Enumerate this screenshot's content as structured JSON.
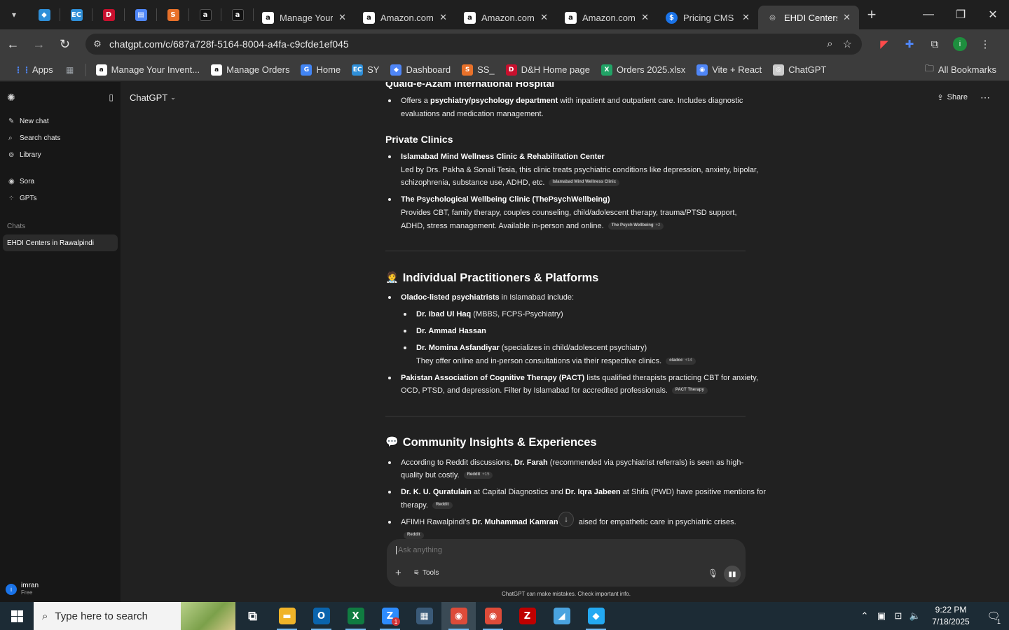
{
  "browser": {
    "pinned_tabs": [
      {
        "icon": "pinned-tab-edge-icon",
        "color": "#2f8fd8",
        "glyph": "◆"
      },
      {
        "icon": "pinned-tab-ec-icon",
        "color": "#2f8fd8",
        "glyph": "EC"
      },
      {
        "icon": "pinned-tab-dh-icon",
        "color": "#c8102e",
        "glyph": "D"
      },
      {
        "icon": "pinned-tab-doc-icon",
        "color": "#4f86f7",
        "glyph": "▤"
      },
      {
        "icon": "pinned-tab-ss-icon",
        "color": "#e8712a",
        "glyph": "S"
      },
      {
        "icon": "pinned-tab-amazon-icon",
        "color": "#ffffff",
        "glyph": "a"
      },
      {
        "icon": "pinned-tab-amazon-icon",
        "color": "#ffffff",
        "glyph": "a"
      }
    ],
    "tabs": [
      {
        "title": "Manage Your",
        "icon": "amazon-icon",
        "active": false
      },
      {
        "title": "Amazon.com",
        "icon": "amazon-icon",
        "active": false
      },
      {
        "title": "Amazon.com",
        "icon": "amazon-icon",
        "active": false
      },
      {
        "title": "Amazon.com",
        "icon": "amazon-icon",
        "active": false
      },
      {
        "title": "Pricing CMS",
        "icon": "dollar-icon",
        "active": false
      },
      {
        "title": "EHDI Centers",
        "icon": "openai-icon",
        "active": true
      }
    ],
    "url": "chatgpt.com/c/687a728f-5164-8004-a4fa-c9cfde1ef045",
    "bookmarks": [
      {
        "label": "Apps",
        "icon": "apps-grid-icon",
        "color": "#4f86f7",
        "glyph": "⋮⋮"
      },
      {
        "label": "",
        "icon": "tab-groups-icon",
        "color": "#9aa0a6",
        "glyph": "▦"
      },
      {
        "label": "Manage Your Invent...",
        "icon": "amazon-icon",
        "color": "#ffffff",
        "glyph": "a"
      },
      {
        "label": "Manage Orders",
        "icon": "amazon-icon",
        "color": "#ffffff",
        "glyph": "a"
      },
      {
        "label": "Home",
        "icon": "google-icon",
        "color": "#4285f4",
        "glyph": "G"
      },
      {
        "label": "SY",
        "icon": "ec-icon",
        "color": "#2f8fd8",
        "glyph": "EC"
      },
      {
        "label": "Dashboard",
        "icon": "dashboard-icon",
        "color": "#4f86f7",
        "glyph": "◆"
      },
      {
        "label": "SS_",
        "icon": "ss-icon",
        "color": "#e8712a",
        "glyph": "S"
      },
      {
        "label": "D&H Home page",
        "icon": "dh-icon",
        "color": "#c8102e",
        "glyph": "D"
      },
      {
        "label": "Orders 2025.xlsx",
        "icon": "excel-icon",
        "color": "#21a366",
        "glyph": "X"
      },
      {
        "label": "Vite + React",
        "icon": "vite-icon",
        "color": "#4f86f7",
        "glyph": "◉"
      },
      {
        "label": "ChatGPT",
        "icon": "openai-icon",
        "color": "#cccccc",
        "glyph": "◎"
      }
    ],
    "all_bookmarks": "All Bookmarks"
  },
  "sidebar": {
    "items": [
      {
        "label": "New chat",
        "icon": "compose-icon",
        "glyph": "✎"
      },
      {
        "label": "Search chats",
        "icon": "search-icon",
        "glyph": "⌕"
      },
      {
        "label": "Library",
        "icon": "library-icon",
        "glyph": "⊚"
      }
    ],
    "items2": [
      {
        "label": "Sora",
        "icon": "sora-icon",
        "glyph": "◉"
      },
      {
        "label": "GPTs",
        "icon": "gpts-icon",
        "glyph": "⁘"
      }
    ],
    "chats_heading": "Chats",
    "active_chat": "EHDI Centers in Rawalpindi",
    "user": {
      "name": "imran",
      "plan": "Free",
      "initial": "i"
    }
  },
  "header": {
    "model": "ChatGPT",
    "share": "Share"
  },
  "conversation": {
    "heading_cut": "Quaid-e-Azam International Hospital",
    "qi_lines": [
      {
        "b": "",
        "t": "Offers a ",
        "b2": "psychiatry/psychology department",
        "t2": " with inpatient and outpatient care. Includes diagnostic"
      },
      {
        "t": "evaluations and medication management."
      }
    ],
    "private_clinics": "Private Clinics",
    "pc1_title": "Islamabad Mind Wellness Clinic & Rehabilitation Center",
    "pc1_line1": "Led by Drs. Pakha & Sonali Tesia, this clinic treats psychiatric conditions like depression, anxiety, bipolar,",
    "pc1_line2": "schizophrenia, substance use, ADHD, etc.",
    "pc1_cite": "Islamabad Mind Wellness Clinic",
    "pc2_title": "The Psychological Wellbeing Clinic (ThePsychWellbeing)",
    "pc2_line1": "Provides CBT, family therapy, couples counseling, child/adolescent therapy, trauma/PTSD support,",
    "pc2_line2": "ADHD, stress management. Available in-person and online.",
    "pc2_cite": "The Psych Wellbeing",
    "pc2_cite_more": "+2",
    "ip_emoji": "🧑‍⚕️",
    "ip_heading": "Individual Practitioners & Platforms",
    "ip1_b": "Oladoc-listed psychiatrists",
    "ip1_t": " in Islamabad include:",
    "doc1_b": "Dr. Ibad Ul Haq",
    "doc1_t": " (MBBS, FCPS-Psychiatry)",
    "doc2_b": "Dr. Ammad Hassan",
    "doc3_b": "Dr. Momina Asfandiyar",
    "doc3_t": " (specializes in child/adolescent psychiatry)",
    "docs_note": "They offer online and in-person consultations via their respective clinics.",
    "docs_cite": "oladoc",
    "docs_cite_more": "+14",
    "pact_b": "Pakistan Association of Cognitive Therapy (PACT)",
    "pact_t": " lists qualified therapists practicing CBT for anxiety,",
    "pact_line2": "OCD, PTSD, and depression. Filter by Islamabad for accredited professionals.",
    "pact_cite": "PACT Therapy",
    "ci_emoji": "💬",
    "ci_heading": "Community Insights & Experiences",
    "ci1_t": "According to Reddit discussions, ",
    "ci1_b": "Dr. Farah",
    "ci1_t2": " (recommended via psychiatrist referrals) is seen as high-",
    "ci1_line2": "quality but costly.",
    "ci1_cite": "Reddit",
    "ci1_cite_more": "+15",
    "ci2_b": "Dr. K. U. Quratulain",
    "ci2_t": " at Capital Diagnostics and ",
    "ci2_b2": "Dr. Iqra Jabeen",
    "ci2_t2": " at Shifa (PWD) have positive mentions for",
    "ci2_line2": "therapy.",
    "ci2_cite": "Reddit",
    "ci3_t": "AFIMH Rawalpindi's ",
    "ci3_b": "Dr. Muhammad Kamran",
    "ci3_t2": " wa",
    "ci3_t3": "aised for empathetic care in psychiatric crises.",
    "ci3_cite": "Reddit"
  },
  "composer": {
    "placeholder": "Ask anything",
    "tools": "Tools"
  },
  "disclaimer": "ChatGPT can make mistakes. Check important info.",
  "taskbar": {
    "search_placeholder": "Type here to search",
    "apps": [
      {
        "icon": "task-view-icon",
        "color": "transparent",
        "glyph": "⧉",
        "running": false
      },
      {
        "icon": "file-explorer-icon",
        "color": "#f0b429",
        "glyph": "▬",
        "running": true
      },
      {
        "icon": "outlook-icon",
        "color": "#0a64ad",
        "glyph": "O",
        "running": true
      },
      {
        "icon": "excel-icon",
        "color": "#107c41",
        "glyph": "X",
        "running": true
      },
      {
        "icon": "zoom-icon",
        "color": "#2d8cff",
        "glyph": "Z",
        "running": true,
        "badge": "1"
      },
      {
        "icon": "calculator-icon",
        "color": "#3a5a78",
        "glyph": "▦",
        "running": false
      },
      {
        "icon": "chrome-icon",
        "color": "#dd4b39",
        "glyph": "◉",
        "running": true,
        "active": true
      },
      {
        "icon": "chrome-icon",
        "color": "#dd4b39",
        "glyph": "◉",
        "running": true
      },
      {
        "icon": "filezilla-icon",
        "color": "#bf0000",
        "glyph": "Z",
        "running": false
      },
      {
        "icon": "notepad-icon",
        "color": "#4aa3df",
        "glyph": "◢",
        "running": false
      },
      {
        "icon": "vscode-icon",
        "color": "#23a9f2",
        "glyph": "◆",
        "running": true
      }
    ],
    "time": "9:22 PM",
    "date": "7/18/2025",
    "notifications": "1"
  }
}
